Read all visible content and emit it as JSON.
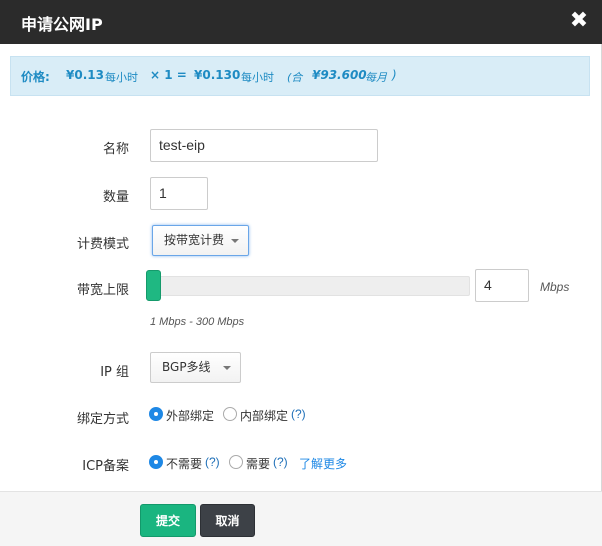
{
  "dialog": {
    "title": "申请公网IP",
    "close_icon": "close-icon",
    "close_glyph": "✖"
  },
  "price": {
    "label": "价格:",
    "unit_price": "¥0.13",
    "unit_price_period": "每小时",
    "multiplier": "× 1 =",
    "total": "¥0.130",
    "total_period": "每小时",
    "month_open": "(合",
    "month_total": "¥93.600",
    "month_period": "每月",
    "month_close": ")"
  },
  "form": {
    "name": {
      "label": "名称",
      "value": "test-eip"
    },
    "count": {
      "label": "数量",
      "value": "1"
    },
    "billing": {
      "label": "计费模式",
      "selected": "按带宽计费"
    },
    "bandwidth": {
      "label": "带宽上限",
      "value": "4",
      "unit": "Mbps",
      "range_hint": "1 Mbps - 300 Mbps",
      "min": 1,
      "max": 300,
      "current": 4
    },
    "ip_group": {
      "label": "IP 组",
      "selected": "BGP多线"
    },
    "bind_mode": {
      "label": "绑定方式",
      "options": [
        {
          "label": "外部绑定",
          "checked": true
        },
        {
          "label": "内部绑定",
          "checked": false
        }
      ],
      "help": "(?)"
    },
    "icp": {
      "label": "ICP备案",
      "options": [
        {
          "label": "不需要",
          "checked": true,
          "help": "(?)"
        },
        {
          "label": "需要",
          "checked": false,
          "help": "(?)"
        }
      ],
      "link": "了解更多"
    }
  },
  "footer": {
    "submit_label": "提交",
    "cancel_label": "取消"
  },
  "colors": {
    "titlebar": "#2b2b2b",
    "price_bg": "#d9edf7",
    "accent_text": "#1e8bc3",
    "submit": "#1ab580",
    "cancel": "#3d4147",
    "radio_checked": "#1e88e5"
  }
}
